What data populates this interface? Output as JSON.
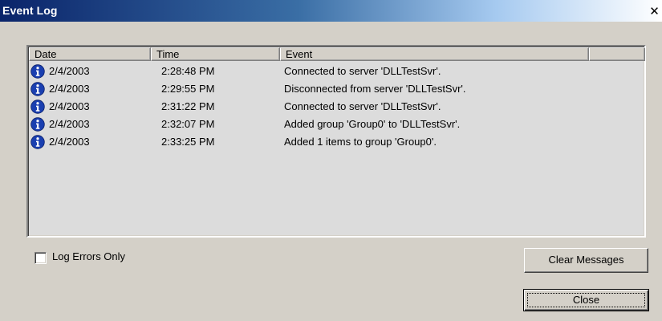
{
  "window": {
    "title": "Event Log",
    "close_glyph": "✕"
  },
  "log": {
    "columns": [
      "Date",
      "Time",
      "Event",
      ""
    ],
    "row_icon": "info-icon",
    "rows": [
      {
        "date": "2/4/2003",
        "time": "2:28:48 PM",
        "event": "Connected to server 'DLLTestSvr'."
      },
      {
        "date": "2/4/2003",
        "time": "2:29:55 PM",
        "event": "Disconnected from server 'DLLTestSvr'."
      },
      {
        "date": "2/4/2003",
        "time": "2:31:22 PM",
        "event": "Connected to server 'DLLTestSvr'."
      },
      {
        "date": "2/4/2003",
        "time": "2:32:07 PM",
        "event": "Added group 'Group0' to 'DLLTestSvr'."
      },
      {
        "date": "2/4/2003",
        "time": "2:33:25 PM",
        "event": "Added 1 items to group 'Group0'."
      }
    ]
  },
  "options": {
    "log_errors_only_label": "Log Errors Only",
    "log_errors_only_checked": false
  },
  "buttons": {
    "clear_label": "Clear Messages",
    "close_label": "Close"
  },
  "colors": {
    "titlebar_start": "#0a246a",
    "titlebar_end": "#a6caf0",
    "dialog_face": "#d4d0c8",
    "list_background": "#dcdcdc",
    "info_icon": "#1a3fb0"
  }
}
